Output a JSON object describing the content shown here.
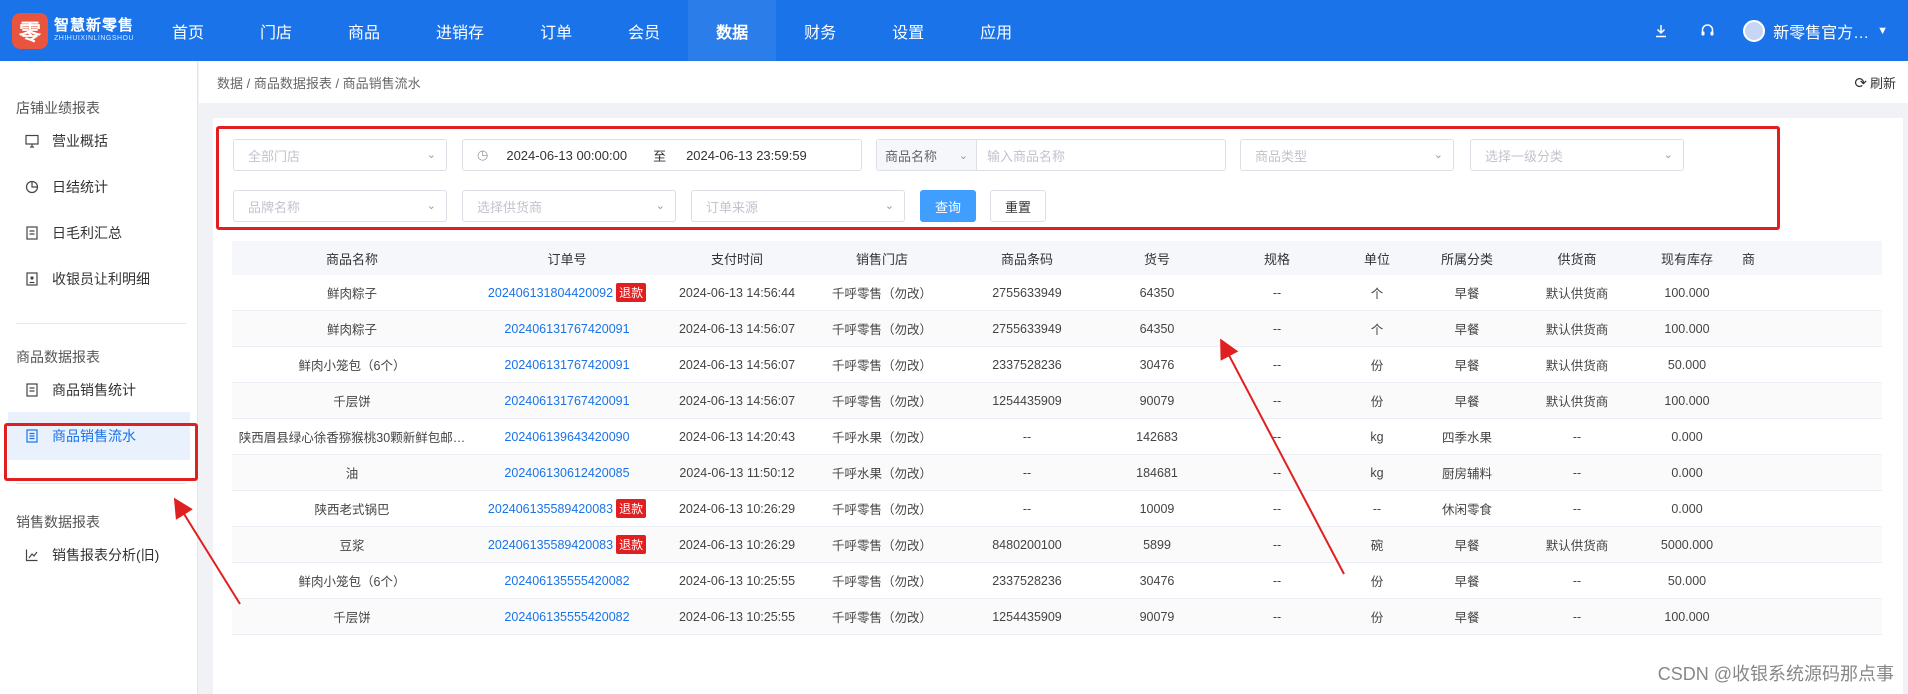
{
  "header": {
    "logo_mark": "零",
    "logo_text": "智慧新零售",
    "logo_subtext": "ZHIHUIXINLINGSHOU",
    "nav": [
      "首页",
      "门店",
      "商品",
      "进销存",
      "订单",
      "会员",
      "数据",
      "财务",
      "设置",
      "应用"
    ],
    "active_nav": "数据",
    "user_name": "新零售官方…"
  },
  "sidebar": {
    "groups": [
      {
        "title": "店铺业绩报表",
        "items": [
          {
            "label": "营业概括",
            "icon": "monitor-icon"
          },
          {
            "label": "日结统计",
            "icon": "pie-icon"
          },
          {
            "label": "日毛利汇总",
            "icon": "doc-icon"
          },
          {
            "label": "收银员让利明细",
            "icon": "doc-user-icon"
          }
        ]
      },
      {
        "title": "商品数据报表",
        "items": [
          {
            "label": "商品销售统计",
            "icon": "doc-icon"
          },
          {
            "label": "商品销售流水",
            "icon": "list-icon",
            "active": true
          }
        ]
      },
      {
        "title": "销售数据报表",
        "items": [
          {
            "label": "销售报表分析(旧)",
            "icon": "chart-icon"
          }
        ]
      }
    ]
  },
  "breadcrumb": "数据 / 商品数据报表 / 商品销售流水",
  "refresh_label": "刷新",
  "filters": {
    "store_placeholder": "全部门店",
    "date_start": "2024-06-13 00:00:00",
    "date_sep": "至",
    "date_end": "2024-06-13 23:59:59",
    "name_type": "商品名称",
    "name_placeholder": "输入商品名称",
    "type_placeholder": "商品类型",
    "category_placeholder": "选择一级分类",
    "brand_placeholder": "品牌名称",
    "supplier_placeholder": "选择供货商",
    "source_placeholder": "订单来源",
    "query_label": "查询",
    "reset_label": "重置"
  },
  "table": {
    "columns": [
      "商品名称",
      "订单号",
      "支付时间",
      "销售门店",
      "商品条码",
      "货号",
      "规格",
      "单位",
      "所属分类",
      "供货商",
      "现有库存",
      "商"
    ],
    "refund_tag": "退款",
    "rows": [
      [
        "鲜肉粽子",
        "202406131804420092",
        "2024-06-13 14:56:44",
        "千呼零售（勿改）",
        "2755633949",
        "64350",
        "--",
        "个",
        "早餐",
        "默认供货商",
        "100.000",
        true
      ],
      [
        "鲜肉粽子",
        "202406131767420091",
        "2024-06-13 14:56:07",
        "千呼零售（勿改）",
        "2755633949",
        "64350",
        "--",
        "个",
        "早餐",
        "默认供货商",
        "100.000",
        false
      ],
      [
        "鲜肉小笼包（6个）",
        "202406131767420091",
        "2024-06-13 14:56:07",
        "千呼零售（勿改）",
        "2337528236",
        "30476",
        "--",
        "份",
        "早餐",
        "默认供货商",
        "50.000",
        false
      ],
      [
        "千层饼",
        "202406131767420091",
        "2024-06-13 14:56:07",
        "千呼零售（勿改）",
        "1254435909",
        "90079",
        "--",
        "份",
        "早餐",
        "默认供货商",
        "100.000",
        false
      ],
      [
        "陕西眉县绿心徐香猕猴桃30颗新鲜包邮…",
        "202406139643420090",
        "2024-06-13 14:20:43",
        "千呼水果（勿改）",
        "--",
        "142683",
        "--",
        "kg",
        "四季水果",
        "--",
        "0.000",
        false
      ],
      [
        "油",
        "202406130612420085",
        "2024-06-13 11:50:12",
        "千呼水果（勿改）",
        "--",
        "184681",
        "--",
        "kg",
        "厨房辅料",
        "--",
        "0.000",
        false
      ],
      [
        "陕西老式锅巴",
        "202406135589420083",
        "2024-06-13 10:26:29",
        "千呼零售（勿改）",
        "--",
        "10009",
        "--",
        "--",
        "休闲零食",
        "--",
        "0.000",
        true
      ],
      [
        "豆浆",
        "202406135589420083",
        "2024-06-13 10:26:29",
        "千呼零售（勿改）",
        "8480200100",
        "5899",
        "--",
        "碗",
        "早餐",
        "默认供货商",
        "5000.000",
        true
      ],
      [
        "鲜肉小笼包（6个）",
        "202406135555420082",
        "2024-06-13 10:25:55",
        "千呼零售（勿改）",
        "2337528236",
        "30476",
        "--",
        "份",
        "早餐",
        "--",
        "50.000",
        false
      ],
      [
        "千层饼",
        "202406135555420082",
        "2024-06-13 10:25:55",
        "千呼零售（勿改）",
        "1254435909",
        "90079",
        "--",
        "份",
        "早餐",
        "--",
        "100.000",
        false
      ]
    ]
  },
  "watermark": "CSDN @收银系统源码那点事",
  "colors": {
    "primary": "#1a73e8",
    "annotation": "#e02020",
    "refund_tag": "#e02020"
  }
}
